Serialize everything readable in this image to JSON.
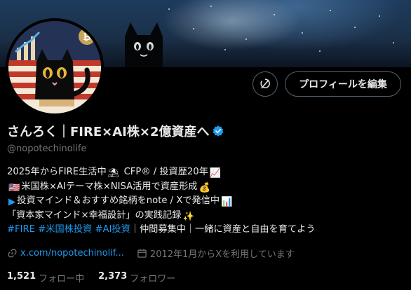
{
  "profile": {
    "display_name": "さんろく｜FIRE×AI株×2億資産へ",
    "handle": "@nopotechinolife",
    "edit_button_label": "プロフィールを編集",
    "bio_lines": [
      [
        "2025年からFIRE生活中",
        "⛱",
        " CFP® / 投資歴20年",
        "📈"
      ],
      [
        "🇺🇸",
        "米国株×AIテーマ株×NISA活用で資産形成",
        "💰"
      ],
      [
        "▶",
        "投資マインド＆おすすめ銘柄をnote / Xで発信中",
        "📊"
      ],
      [
        "「資本家マインド×幸福設計」の実践記録",
        "✨"
      ]
    ],
    "bio_tags_line": {
      "tags": [
        "#FIRE",
        "#米国株投資",
        "#AI投資"
      ],
      "rest": "｜仲間募集中｜一緒に資産と自由を育てよう"
    },
    "link": "x.com/nopotechinolif...",
    "joined": "2012年1月からXを利用しています",
    "following_count": "1,521",
    "following_label": "フォロー中",
    "followers_count": "2,373",
    "followers_label": "フォロワー"
  },
  "colors": {
    "accent": "#1d9bf0",
    "secondary_text": "#71767b",
    "primary_text": "#e7e9ea",
    "background": "#000000",
    "border": "#536471"
  },
  "icons": {
    "verified": "verified-badge-icon",
    "link": "link-icon",
    "calendar": "calendar-icon",
    "no_notify": "notification-off-icon"
  }
}
